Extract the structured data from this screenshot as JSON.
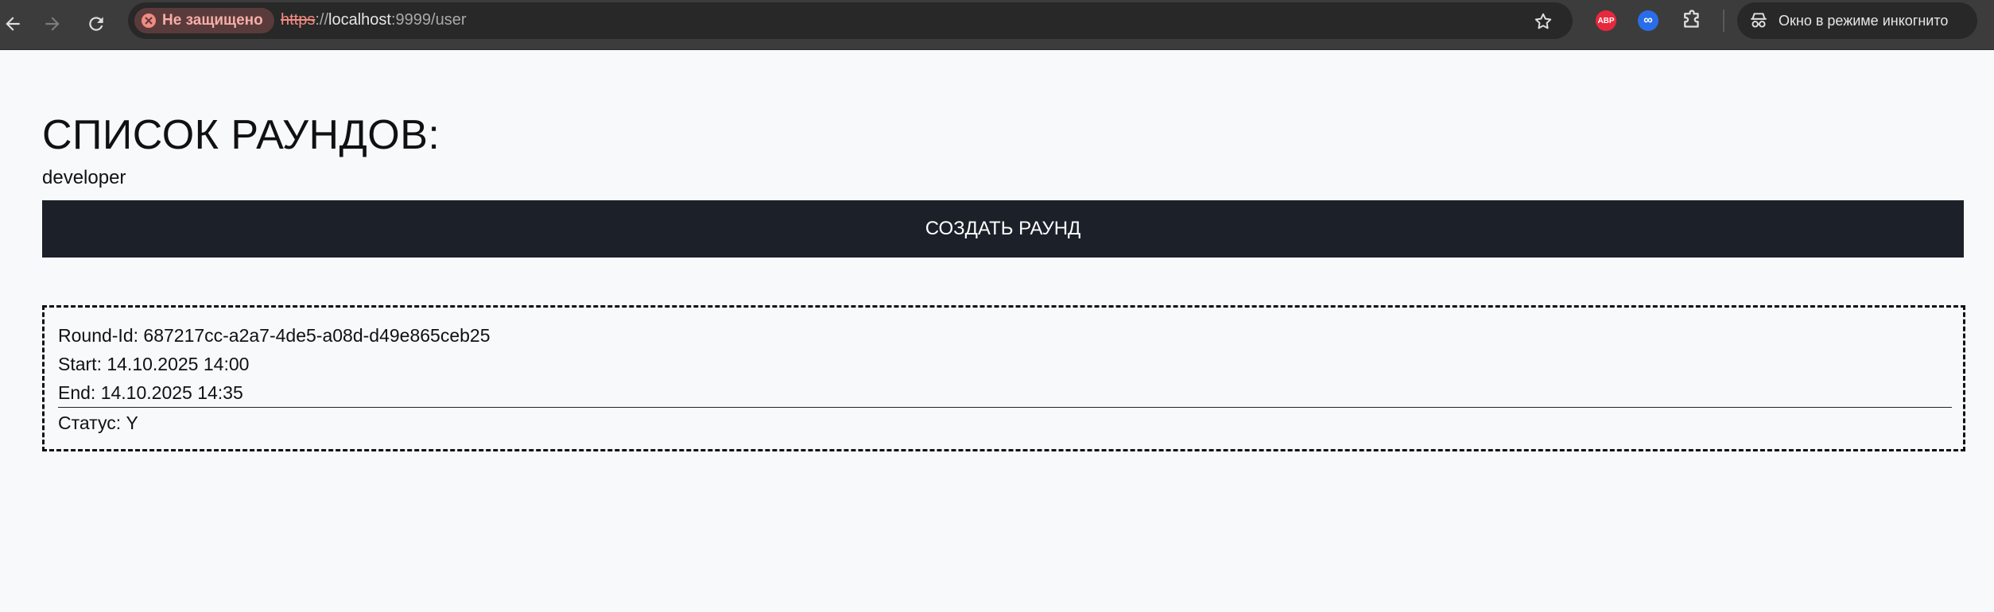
{
  "browser": {
    "security_label": "Не защищено",
    "url_scheme": "https",
    "url_sep": "://",
    "url_host": "localhost",
    "url_path": ":9999/user",
    "extensions": [
      {
        "name": "adblock-plus",
        "text": "ABP",
        "color": "#e8283c"
      },
      {
        "name": "infinity",
        "text": "∞",
        "color": "#2a6de8"
      }
    ],
    "incognito_label": "Окно в режиме инкогнито"
  },
  "page": {
    "title": "СПИСОК РАУНДОВ:",
    "username": "developer",
    "create_button": "СОЗДАТЬ РАУНД",
    "rounds": [
      {
        "round_id": "Round-Id: 687217cc-a2a7-4de5-a08d-d49e865ceb25",
        "start": "Start: 14.10.2025 14:00",
        "end": "End: 14.10.2025 14:35",
        "status": "Статус: Y"
      }
    ]
  },
  "colors": {
    "background": "#f8f9fb",
    "button_bg": "#1b2029",
    "button_text": "#ffffff",
    "chrome_bg": "#3c3c3c",
    "insecure": "#f28b82"
  }
}
